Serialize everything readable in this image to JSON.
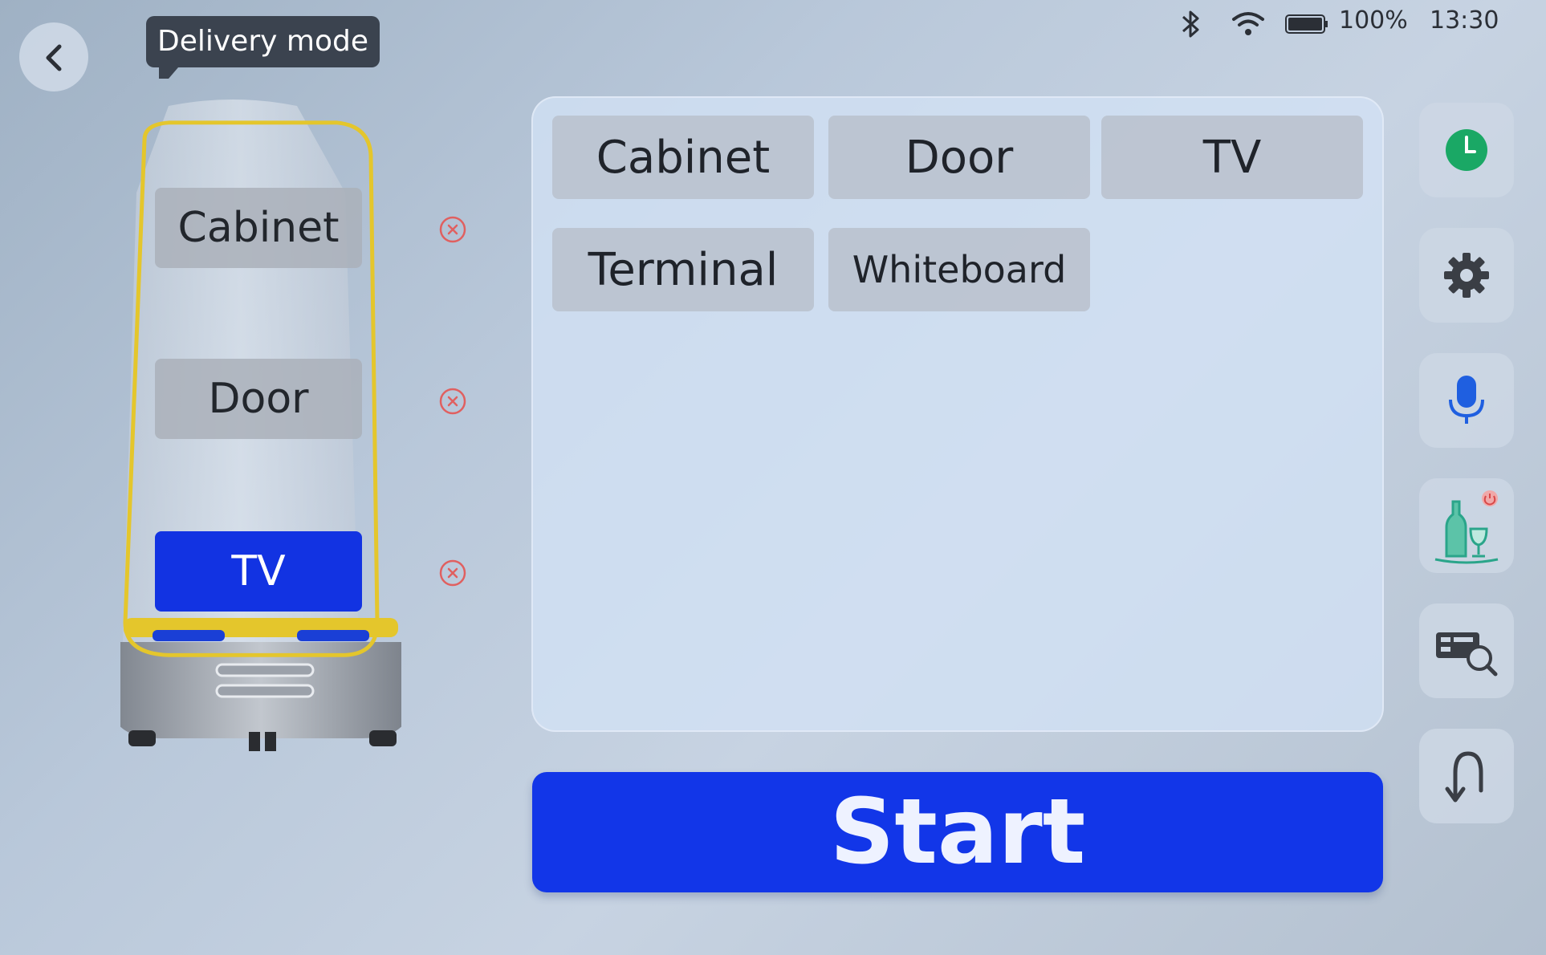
{
  "status_bar": {
    "battery_percent": "100%",
    "time": "13:30"
  },
  "header": {
    "mode_label": "Delivery mode"
  },
  "robot_trays": [
    {
      "label": "Cabinet",
      "active": false
    },
    {
      "label": "Door",
      "active": false
    },
    {
      "label": "TV",
      "active": true
    }
  ],
  "destinations": [
    {
      "label": "Cabinet"
    },
    {
      "label": "Door"
    },
    {
      "label": "TV"
    },
    {
      "label": "Terminal"
    },
    {
      "label": "Whiteboard"
    }
  ],
  "start_label": "Start",
  "toolbar": [
    "clock-icon",
    "gear-icon",
    "microphone-icon",
    "bottle-glass-icon",
    "card-search-icon",
    "return-arrow-icon"
  ],
  "colors": {
    "accent": "#1236e8",
    "tray_outline": "#e4c62c",
    "remove": "#e06060",
    "clock": "#1aa865",
    "bottle": "#2aa58a"
  }
}
